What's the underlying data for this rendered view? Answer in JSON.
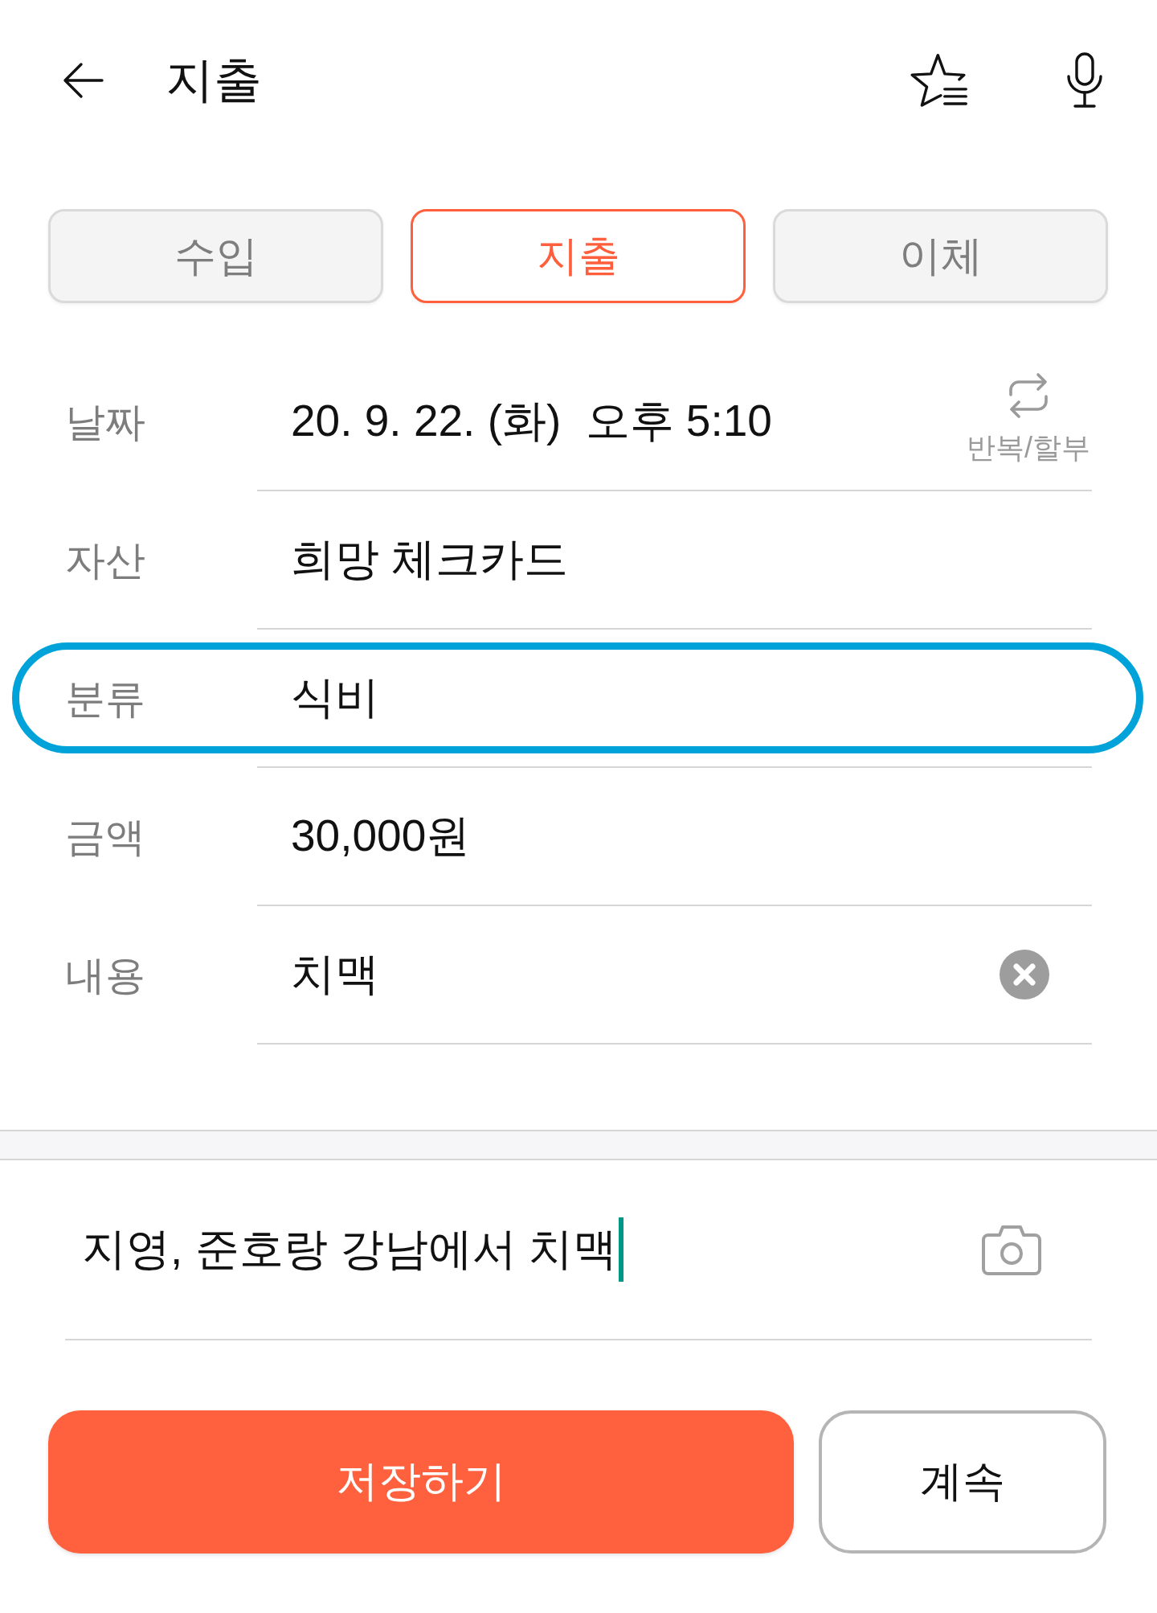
{
  "header": {
    "title": "지출"
  },
  "tabs": [
    {
      "label": "수입",
      "selected": false
    },
    {
      "label": "지출",
      "selected": true
    },
    {
      "label": "이체",
      "selected": false
    }
  ],
  "fields": [
    {
      "kind": "datetime",
      "label": "날짜",
      "date": "20. 9. 22. (화)",
      "time": "오후 5:10",
      "action_label": "반복/할부",
      "highlighted": false
    },
    {
      "kind": "picker",
      "label": "자산",
      "value": "희망 체크카드",
      "highlighted": false
    },
    {
      "kind": "picker",
      "label": "분류",
      "value": "식비",
      "highlighted": true
    },
    {
      "kind": "number",
      "label": "금액",
      "value": "30,000원",
      "highlighted": false
    },
    {
      "kind": "text",
      "label": "내용",
      "value": "치맥",
      "highlighted": false
    }
  ],
  "memo": {
    "value": "지영, 준호랑 강남에서 치맥",
    "focused": true
  },
  "buttons": [
    {
      "kind": "primary",
      "label": "저장하기"
    },
    {
      "kind": "secondary",
      "label": "계속"
    }
  ]
}
